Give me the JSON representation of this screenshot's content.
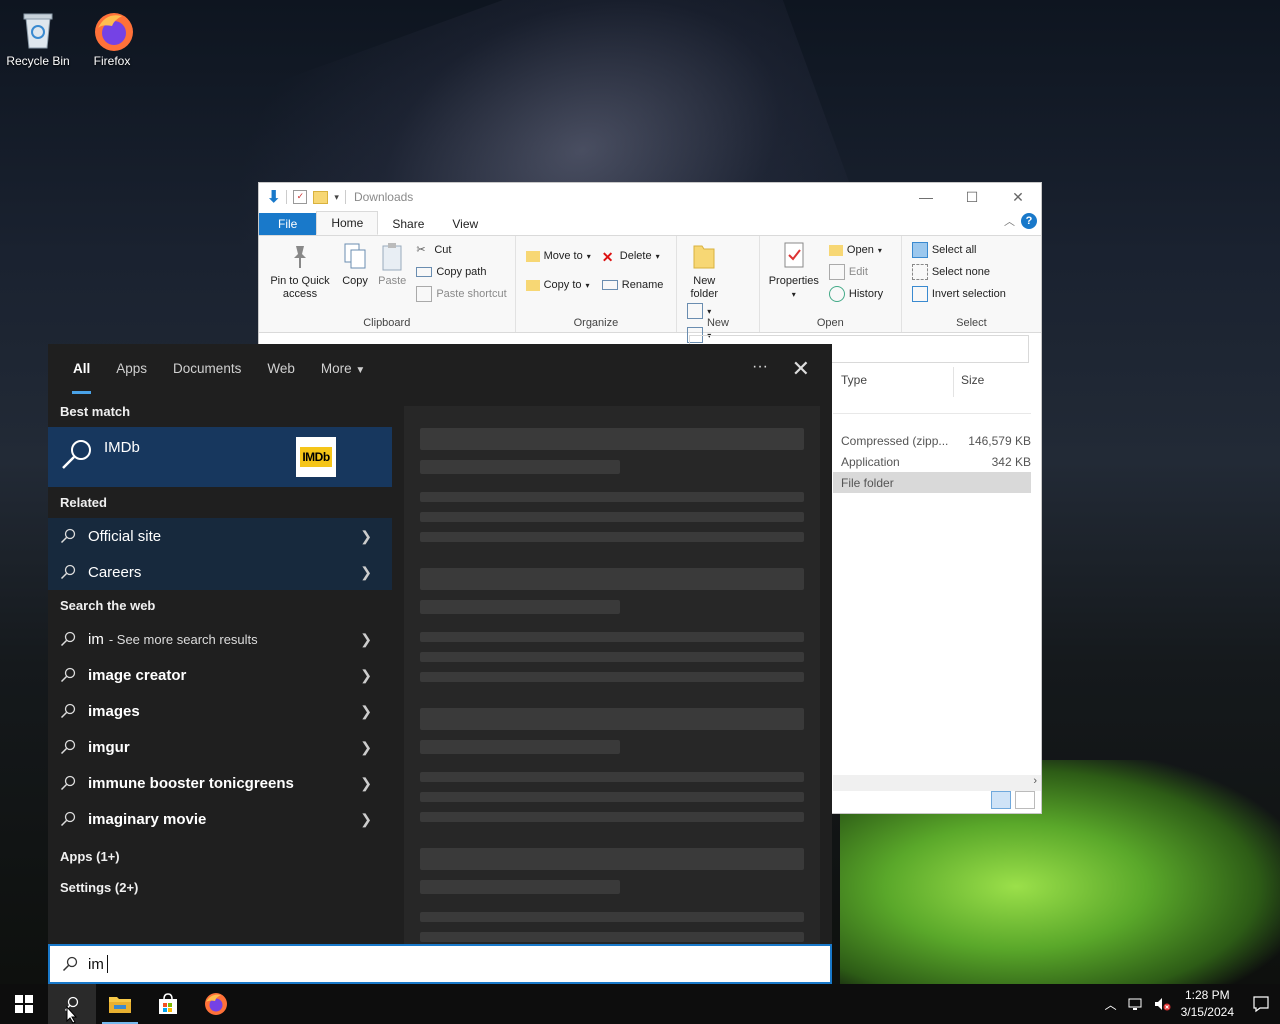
{
  "desktop": {
    "icons": [
      {
        "label": "Recycle Bin"
      },
      {
        "label": "Firefox"
      }
    ]
  },
  "explorer": {
    "title": "Downloads",
    "tabs": {
      "file": "File",
      "home": "Home",
      "share": "Share",
      "view": "View"
    },
    "clipboard": {
      "pin": "Pin to Quick access",
      "copy": "Copy",
      "paste": "Paste",
      "cut": "Cut",
      "copy_path": "Copy path",
      "paste_shortcut": "Paste shortcut",
      "label": "Clipboard"
    },
    "organize": {
      "move_to": "Move to",
      "copy_to": "Copy to",
      "delete": "Delete",
      "rename": "Rename",
      "label": "Organize"
    },
    "new": {
      "new_folder": "New folder",
      "label": "New"
    },
    "open": {
      "properties": "Properties",
      "open": "Open",
      "edit": "Edit",
      "history": "History",
      "label": "Open"
    },
    "select": {
      "select_all": "Select all",
      "select_none": "Select none",
      "invert": "Invert selection",
      "label": "Select"
    },
    "columns": {
      "type": "Type",
      "size": "Size"
    },
    "files": [
      {
        "type": "Compressed (zipp...",
        "size": "146,579 KB"
      },
      {
        "type": "Application",
        "size": "342 KB"
      },
      {
        "type": "File folder",
        "size": ""
      }
    ]
  },
  "search": {
    "tabs": [
      "All",
      "Apps",
      "Documents",
      "Web",
      "More"
    ],
    "best_match_heading": "Best match",
    "best_match": {
      "name": "IMDb",
      "logo_text": "IMDb"
    },
    "related_heading": "Related",
    "related": [
      "Official site",
      "Careers"
    ],
    "web_heading": "Search the web",
    "web_first": {
      "query": "im",
      "suffix": "- See more search results"
    },
    "web_results": [
      "image creator",
      "images",
      "imgur",
      "immune booster tonicgreens",
      "imaginary movie"
    ],
    "apps_count": "Apps (1+)",
    "settings_count": "Settings (2+)",
    "query": "im"
  },
  "taskbar": {
    "time": "1:28 PM",
    "date": "3/15/2024"
  },
  "colors": {
    "accent": "#1979ca",
    "best_match_bg": "#17375e"
  }
}
